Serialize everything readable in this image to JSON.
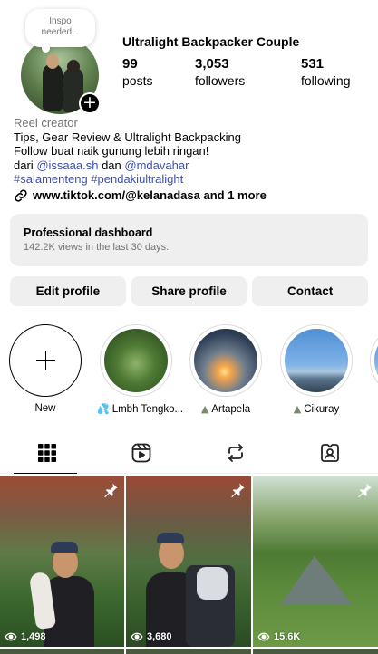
{
  "note": {
    "line1": "Inspo",
    "line2": "needed..."
  },
  "profile": {
    "name": "Ultralight Backpacker Couple",
    "stats": [
      {
        "num": "99",
        "label": "posts"
      },
      {
        "num": "3,053",
        "label": "followers"
      },
      {
        "num": "531",
        "label": "following"
      }
    ]
  },
  "bio": {
    "category": "Reel creator",
    "line1": "Tips, Gear Review & Ultralight Backpacking",
    "line2": "Follow buat naik gunung lebih ringan!",
    "line3_prefix": "dari",
    "mention1": "@issaaa.sh",
    "line3_mid": "dan",
    "mention2": "@mdavahar",
    "hashtag1": "#salamenteng",
    "hashtag2": "#pendakiultralight",
    "link": "www.tiktok.com/@kelanadasa and 1 more"
  },
  "dashboard": {
    "title": "Professional dashboard",
    "subtitle": "142.2K views in the last 30 days."
  },
  "buttons": {
    "edit": "Edit profile",
    "share": "Share profile",
    "contact": "Contact"
  },
  "highlights": [
    {
      "label": "New"
    },
    {
      "emoji": "💦",
      "label": "Lmbh Tengko..."
    },
    {
      "emoji": "▲",
      "label": "Artapela"
    },
    {
      "emoji": "▲",
      "label": "Cikuray"
    }
  ],
  "tabs": [
    "grid-icon",
    "reels-icon",
    "reposts-icon",
    "tagged-icon"
  ],
  "posts": [
    {
      "views": "1,498",
      "pinned": true
    },
    {
      "views": "3,680",
      "pinned": true
    },
    {
      "views": "15.6K",
      "pinned": true
    }
  ],
  "colors": {
    "accent_link": "#3b4fb0",
    "button_bg": "#efefef",
    "muted": "#737373"
  }
}
